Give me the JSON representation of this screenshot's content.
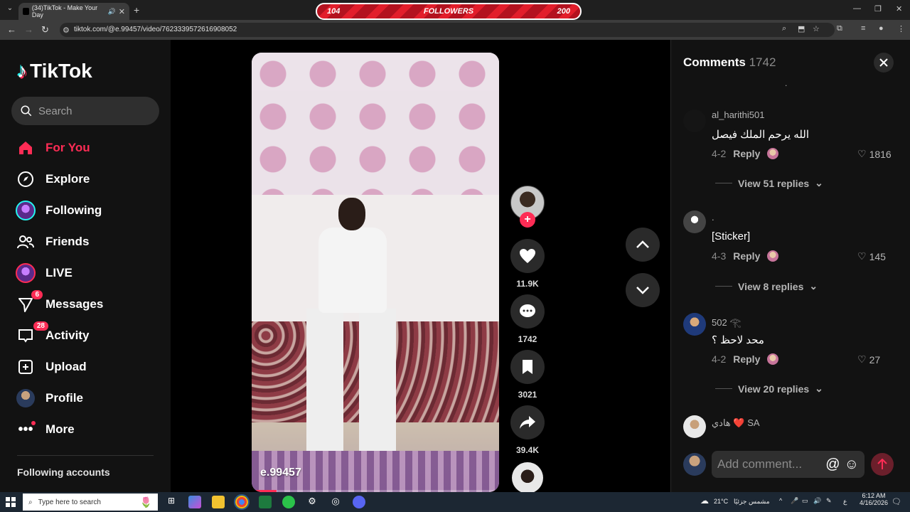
{
  "browser": {
    "tab_title": "(34)TikTok - Make Your Day",
    "url": "tiktok.com/@e.99457/video/7623339572616908052",
    "overlay": {
      "left": "104",
      "center": "FOLLOWERS",
      "right": "200"
    }
  },
  "sidebar": {
    "logo": "TikTok",
    "search_placeholder": "Search",
    "items": [
      {
        "label": "For You"
      },
      {
        "label": "Explore"
      },
      {
        "label": "Following"
      },
      {
        "label": "Friends"
      },
      {
        "label": "LIVE"
      },
      {
        "label": "Messages",
        "badge": "6"
      },
      {
        "label": "Activity",
        "badge": "28"
      },
      {
        "label": "Upload"
      },
      {
        "label": "Profile"
      },
      {
        "label": "More"
      }
    ],
    "following_accounts": "Following accounts"
  },
  "video": {
    "username": "e.99457",
    "progress": 0.1
  },
  "actions": {
    "likes": "11.9K",
    "comments": "1742",
    "saves": "3021",
    "shares": "39.4K"
  },
  "comments": {
    "title": "Comments",
    "count": "1742",
    "top_fragment": ".",
    "items": [
      {
        "user": "al_harithi501",
        "text": "الله يرحم الملك فيصل",
        "date": "4-2",
        "reply": "Reply",
        "likes": "1816",
        "view_replies": "View 51 replies"
      },
      {
        "user": ".",
        "text": "[Sticker]",
        "date": "4-3",
        "reply": "Reply",
        "likes": "145",
        "view_replies": "View 8 replies"
      },
      {
        "user": "502 𓂀",
        "text": "محد لاحظ ؟",
        "date": "4-2",
        "reply": "Reply",
        "likes": "27",
        "view_replies": "View 20 replies"
      },
      {
        "user": "هادي ❤️ SA"
      }
    ],
    "input_placeholder": "Add comment..."
  },
  "taskbar": {
    "search_placeholder": "Type here to search",
    "weather": "21°C",
    "weather_text": "مشمس جزئيًا",
    "time": "6:12 AM",
    "date": "4/16/2026",
    "lang": "ع"
  },
  "colors": {
    "accent": "#fe2c55",
    "cyan": "#25f4ee"
  }
}
